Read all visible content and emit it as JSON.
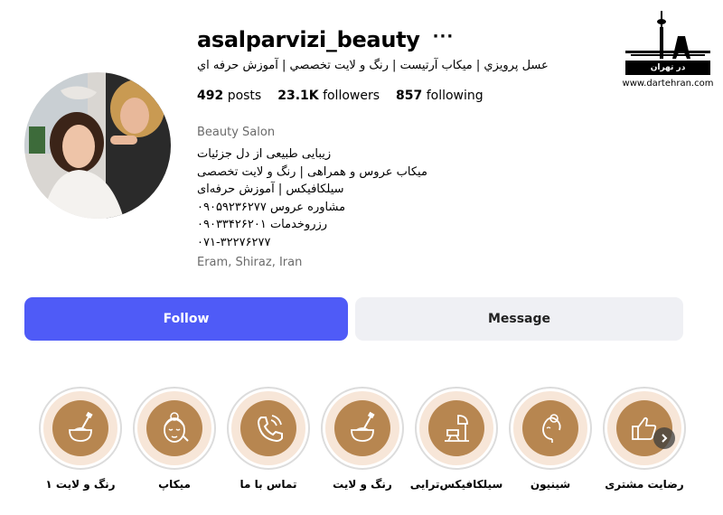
{
  "profile": {
    "username": "asalparvizi_beauty",
    "more_glyph": "···",
    "full_name": "عسل پرويزي | ميكاب آرتيست | رنگ و لايت تخصصي | آموزش حرفه اي",
    "stats": {
      "posts_count": "492",
      "posts_label": "posts",
      "followers_count": "23.1K",
      "followers_label": "followers",
      "following_count": "857",
      "following_label": "following"
    },
    "category": "Beauty Salon",
    "bio_lines": [
      "زیبایی طبیعی از دل جزئیات",
      "میکاب عروس و همراهی | رنگ و لایت تخصصی",
      "سیلکافیکس | آموزش حرفه‌ای",
      "مشاوره عروس ۰۹۰۵۹۲۳۶۲۷۷",
      "رزروخدمات ۰۹۰۳۳۴۲۶۲۰۱",
      "۰۷۱-۳۲۲۷۶۲۷۷"
    ],
    "location": "Eram, Shiraz, Iran"
  },
  "watermark": {
    "name": "در تهران",
    "url": "www.dartehran.com"
  },
  "actions": {
    "follow_label": "Follow",
    "message_label": "Message"
  },
  "highlights": [
    {
      "label": "رنگ و لایت ۱",
      "icon": "hair-dye-brush-icon"
    },
    {
      "label": "میکاپ",
      "icon": "makeup-face-icon"
    },
    {
      "label": "تماس با ما",
      "icon": "phone-call-icon"
    },
    {
      "label": "رنگ و لایت",
      "icon": "hair-dye-brush-icon"
    },
    {
      "label": "سیلکافیکس‌ترایی",
      "icon": "salon-chair-icon"
    },
    {
      "label": "شینیون",
      "icon": "updo-hairstyle-icon"
    },
    {
      "label": "رضایت مشتری",
      "icon": "thumbs-up-icon"
    }
  ],
  "colors": {
    "follow_button": "#4f5bf7",
    "message_button": "#eff0f4",
    "highlight_blob": "#b78650",
    "highlight_ring": "#f7e6d8"
  }
}
